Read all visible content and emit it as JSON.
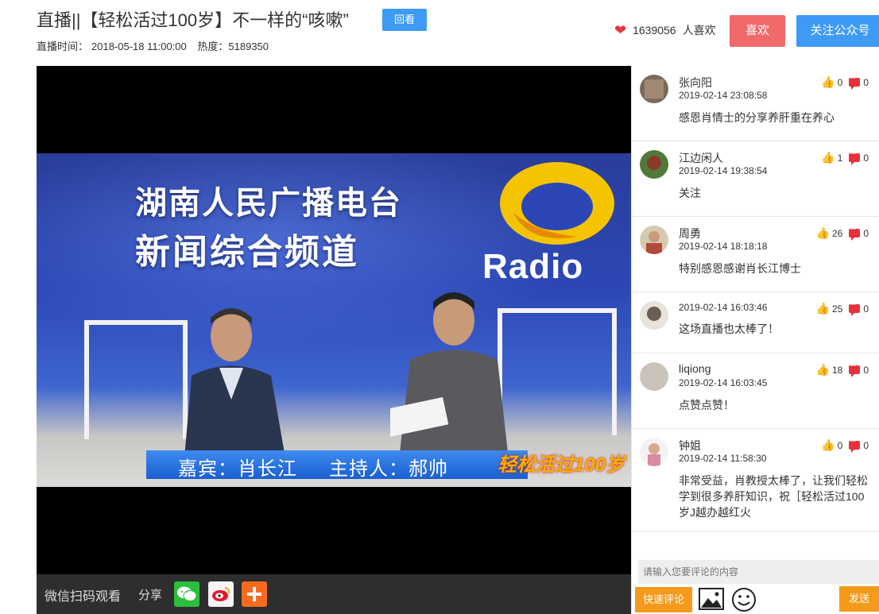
{
  "header": {
    "title": "直播||【轻松活过100岁】不一样的“咳嗽”",
    "replay_label": "回看",
    "live_time_label": "直播时间：",
    "live_time": "2018-05-18 11:00:00",
    "heat_label": "热度：",
    "heat_value": "5189350",
    "likes_count": "1639056",
    "likes_unit": "人喜欢",
    "like_button": "喜欢",
    "follow_button": "关注公众号"
  },
  "video": {
    "station_line1": "湖南人民广播电台",
    "station_line2": "新闻综合频道",
    "logo_text": "Radio",
    "caption_guest": "嘉宾：肖长江",
    "caption_host": "主持人：郝帅",
    "caption_logo": "轻松活过100岁"
  },
  "player_bar": {
    "qr_label": "微信扫码观看",
    "share_label": "分享"
  },
  "comments": [
    {
      "name": "张向阳",
      "time": "2019-02-14 23:08:58",
      "text": "感恩肖情士的分享养肝重在养心",
      "likes": "0",
      "replies": "0",
      "avatar_color": "#7a6a5a"
    },
    {
      "name": "江边闲人",
      "time": "2019-02-14 19:38:54",
      "text": "关注",
      "likes": "1",
      "replies": "0",
      "avatar_color": "#4f7a3a"
    },
    {
      "name": "周勇",
      "time": "2019-02-14 18:18:18",
      "text": "特别感恩感谢肖长江博士",
      "likes": "26",
      "replies": "0",
      "avatar_color": "#b04a3a"
    },
    {
      "name": "",
      "time": "2019-02-14 16:03:46",
      "text": "这场直播也太棒了！",
      "likes": "25",
      "replies": "0",
      "avatar_color": "#6a5e54"
    },
    {
      "name": "liqiong",
      "time": "2019-02-14 16:03:45",
      "text": "点赞点赞！",
      "likes": "18",
      "replies": "0",
      "avatar_color": "#c9c3bb"
    },
    {
      "name": "钟姐",
      "time": "2019-02-14 11:58:30",
      "text": "非常受益，肖教授太棒了，让我们轻松学到很多养肝知识，祝［轻松活过100岁J越办越红火",
      "likes": "0",
      "replies": "0",
      "avatar_color": "#d98aa0"
    }
  ],
  "comment_box": {
    "placeholder": "请输入您要评论的内容",
    "quick_comment": "快速评论",
    "send": "发送"
  },
  "colors": {
    "accent_blue": "#3d9bf5",
    "like_red": "#f06a6a",
    "heart_red": "#e8313a",
    "orange": "#f59a1b"
  }
}
